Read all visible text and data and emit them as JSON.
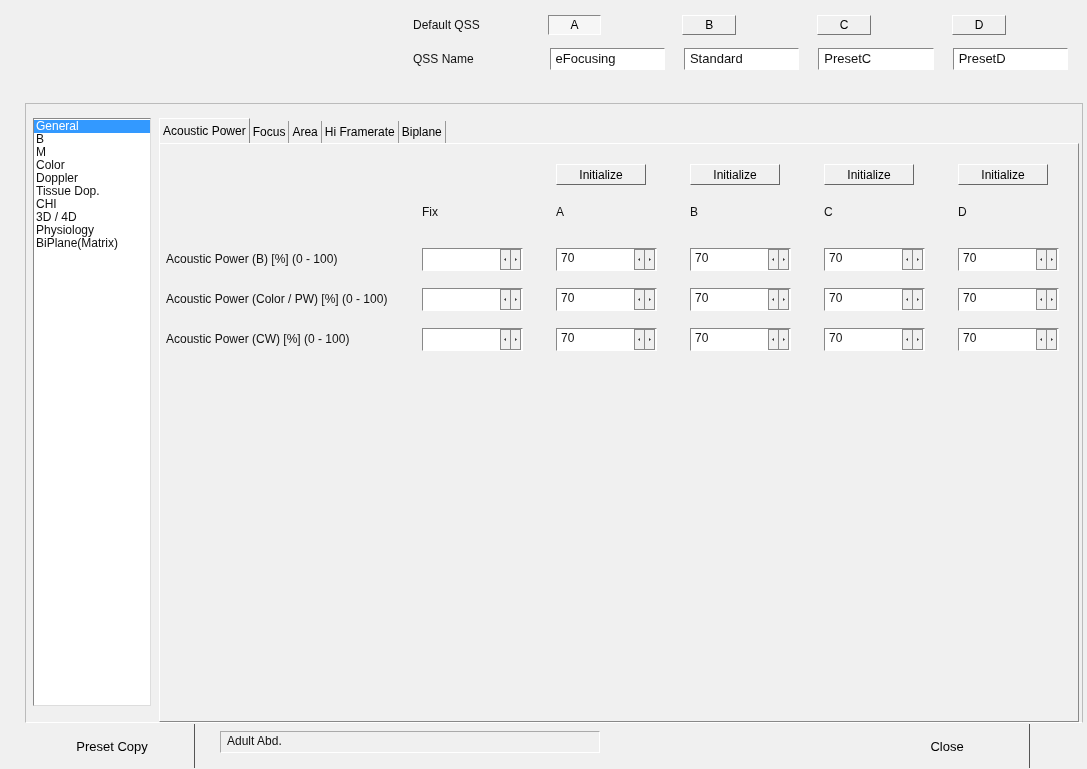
{
  "default_qss": {
    "label": "Default QSS",
    "buttons": [
      {
        "label": "A",
        "selected": true
      },
      {
        "label": "B",
        "selected": false
      },
      {
        "label": "C",
        "selected": false
      },
      {
        "label": "D",
        "selected": false
      }
    ]
  },
  "qss_name": {
    "label": "QSS Name",
    "values": [
      "eFocusing",
      "Standard",
      "PresetC",
      "PresetD"
    ]
  },
  "sidebar": {
    "items": [
      {
        "label": "General",
        "selected": true
      },
      {
        "label": "B",
        "selected": false
      },
      {
        "label": "M",
        "selected": false
      },
      {
        "label": "Color",
        "selected": false
      },
      {
        "label": "Doppler",
        "selected": false
      },
      {
        "label": "Tissue Dop.",
        "selected": false
      },
      {
        "label": "CHI",
        "selected": false
      },
      {
        "label": "3D / 4D",
        "selected": false
      },
      {
        "label": "Physiology",
        "selected": false
      },
      {
        "label": "BiPlane(Matrix)",
        "selected": false
      }
    ]
  },
  "tabs": [
    {
      "label": "Acoustic Power",
      "selected": true
    },
    {
      "label": "Focus",
      "selected": false
    },
    {
      "label": "Area",
      "selected": false
    },
    {
      "label": "Hi Framerate",
      "selected": false
    },
    {
      "label": "Biplane",
      "selected": false
    }
  ],
  "initialize_buttons": [
    "Initialize",
    "Initialize",
    "Initialize",
    "Initialize"
  ],
  "columns": [
    "Fix",
    "A",
    "B",
    "C",
    "D"
  ],
  "rows": [
    {
      "label": "Acoustic Power (B) [%] (0 - 100)",
      "values": [
        "70",
        "70",
        "70",
        "70"
      ]
    },
    {
      "label": "Acoustic Power (Color / PW) [%] (0 - 100)",
      "values": [
        "70",
        "70",
        "70",
        "70"
      ]
    },
    {
      "label": "Acoustic Power (CW) [%] (0 - 100)",
      "values": [
        "70",
        "70",
        "70",
        "70"
      ]
    }
  ],
  "footer": {
    "preset_copy": "Preset Copy",
    "preset_name": "Adult Abd.",
    "close": "Close"
  }
}
